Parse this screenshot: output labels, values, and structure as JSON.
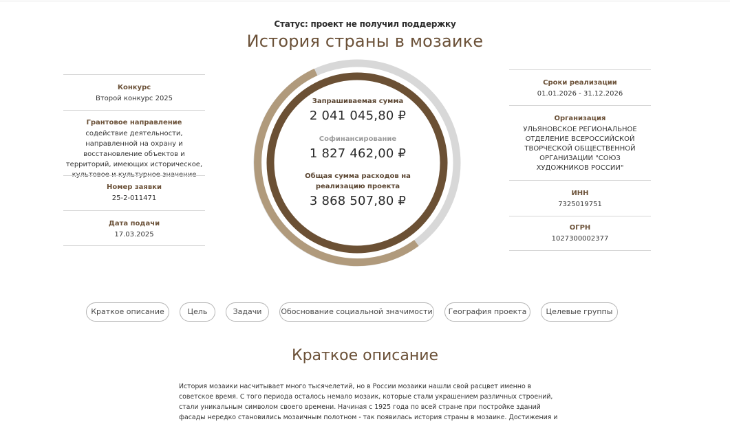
{
  "status": "Статус: проект не получил поддержку",
  "title": "История страны в мозаике",
  "colors": {
    "accent": "#6b5138",
    "ring_dark": "#6b5034",
    "ring_light": "#b09a7c",
    "ring_track": "#d8d8d8"
  },
  "left_info": [
    {
      "label": "Конкурс",
      "value": "Второй конкурс 2025"
    },
    {
      "label": "Грантовое направление",
      "value": "содействие деятельности, направленной на охрану и восстановление объектов и территорий, имеющих историческое, культовое и культурное значение"
    },
    {
      "label": "Номер заявки",
      "value": "25-2-011471"
    },
    {
      "label": "Дата подачи",
      "value": "17.03.2025"
    }
  ],
  "right_info": [
    {
      "label": "Сроки реализации",
      "value": "01.01.2026 - 31.12.2026"
    },
    {
      "label": "Организация",
      "value": "УЛЬЯНОВСКОЕ РЕГИОНАЛЬНОЕ ОТДЕЛЕНИЕ ВСЕРОССИЙСКОЙ ТВОРЧЕСКОЙ ОБЩЕСТВЕННОЙ ОРГАНИЗАЦИИ \"СОЮЗ ХУДОЖНИКОВ РОССИИ\""
    },
    {
      "label": "ИНН",
      "value": "7325019751"
    },
    {
      "label": "ОГРН",
      "value": "1027300002377"
    }
  ],
  "center": {
    "requested_label": "Запрашиваемая сумма",
    "requested_value": "2 041 045,80 ₽",
    "cofinancing_label": "Софинансирование",
    "cofinancing_value": "1 827 462,00 ₽",
    "total_label": "Общая сумма расходов на реализацию проекта",
    "total_value": "3 868 507,80 ₽"
  },
  "tabs": [
    "Краткое описание",
    "Цель",
    "Задачи",
    "Обоснование социальной значимости",
    "География проекта",
    "Целевые группы"
  ],
  "section": {
    "title": "Краткое описание",
    "lines": [
      "История мозаики насчитывает много тысячелетий, но в России мозаики нашли свой расцвет именно в",
      "советское время. С того периода осталось немало мозаик, которые стали украшением различных строений,",
      "стали уникальным символом своего времени. Начиная с 1925 года по всей стране при постройке зданий",
      "фасады нередко становились мозаичным полотном - так появилась история страны в мозаике. Достижения и"
    ]
  }
}
